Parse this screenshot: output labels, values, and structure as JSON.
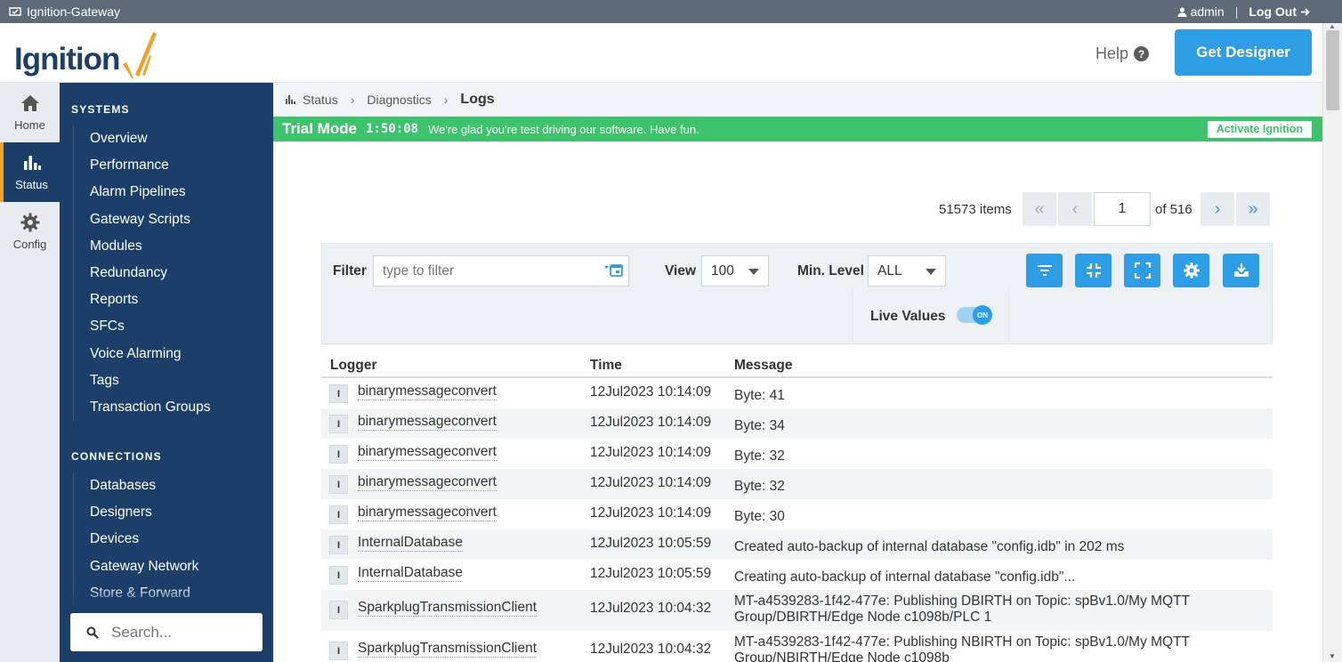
{
  "window": {
    "title": "Ignition-Gateway",
    "user": "admin",
    "separator": "|",
    "logout": "Log Out"
  },
  "header": {
    "logo_text": "Ignition",
    "help": "Help",
    "get_designer": "Get Designer"
  },
  "nav": {
    "home": "Home",
    "status": "Status",
    "config": "Config"
  },
  "sidebar": {
    "systems_title": "SYSTEMS",
    "systems": [
      "Overview",
      "Performance",
      "Alarm Pipelines",
      "Gateway Scripts",
      "Modules",
      "Redundancy",
      "Reports",
      "SFCs",
      "Voice Alarming",
      "Tags",
      "Transaction Groups"
    ],
    "connections_title": "CONNECTIONS",
    "connections": [
      "Databases",
      "Designers",
      "Devices",
      "Gateway Network",
      "Store & Forward"
    ],
    "search_placeholder": "Search..."
  },
  "breadcrumb": {
    "status": "Status",
    "diagnostics": "Diagnostics",
    "current": "Logs"
  },
  "trial": {
    "label": "Trial Mode",
    "timer": "1:50:08",
    "message": "We're glad you're test driving our software. Have fun.",
    "activate": "Activate Ignition"
  },
  "pager": {
    "items": "51573 items",
    "first": "«",
    "prev": "‹",
    "page": "1",
    "of": "of 516",
    "next": "›",
    "last": "»"
  },
  "toolbar": {
    "filter_label": "Filter",
    "filter_placeholder": "type to filter",
    "view_label": "View",
    "view_value": "100",
    "min_level_label": "Min. Level",
    "min_level_value": "ALL",
    "live_label": "Live Values",
    "live_state": "ON"
  },
  "table": {
    "columns": [
      "Logger",
      "Time",
      "Message"
    ],
    "rows": [
      {
        "level": "I",
        "logger": "binarymessageconvert",
        "time": "12Jul2023 10:14:09",
        "message": "Byte: 41"
      },
      {
        "level": "I",
        "logger": "binarymessageconvert",
        "time": "12Jul2023 10:14:09",
        "message": "Byte: 34"
      },
      {
        "level": "I",
        "logger": "binarymessageconvert",
        "time": "12Jul2023 10:14:09",
        "message": "Byte: 32"
      },
      {
        "level": "I",
        "logger": "binarymessageconvert",
        "time": "12Jul2023 10:14:09",
        "message": "Byte: 32"
      },
      {
        "level": "I",
        "logger": "binarymessageconvert",
        "time": "12Jul2023 10:14:09",
        "message": "Byte: 30"
      },
      {
        "level": "I",
        "logger": "InternalDatabase",
        "time": "12Jul2023 10:05:59",
        "message": "Created auto-backup of internal database \"config.idb\" in 202 ms"
      },
      {
        "level": "I",
        "logger": "InternalDatabase",
        "time": "12Jul2023 10:05:59",
        "message": "Creating auto-backup of internal database \"config.idb\"..."
      },
      {
        "level": "I",
        "logger": "SparkplugTransmissionClient",
        "time": "12Jul2023 10:04:32",
        "message": "MT-a4539283-1f42-477e: Publishing DBIRTH on Topic: spBv1.0/My MQTT Group/DBIRTH/Edge Node c1098b/PLC 1"
      },
      {
        "level": "I",
        "logger": "SparkplugTransmissionClient",
        "time": "12Jul2023 10:04:32",
        "message": "MT-a4539283-1f42-477e: Publishing NBIRTH on Topic: spBv1.0/My MQTT Group/NBIRTH/Edge Node c1098b"
      }
    ]
  },
  "colors": {
    "navy": "#1b3f68",
    "accent_blue": "#2d9ee6",
    "trial_green": "#3cc36b",
    "logo_orange": "#f4a024"
  }
}
